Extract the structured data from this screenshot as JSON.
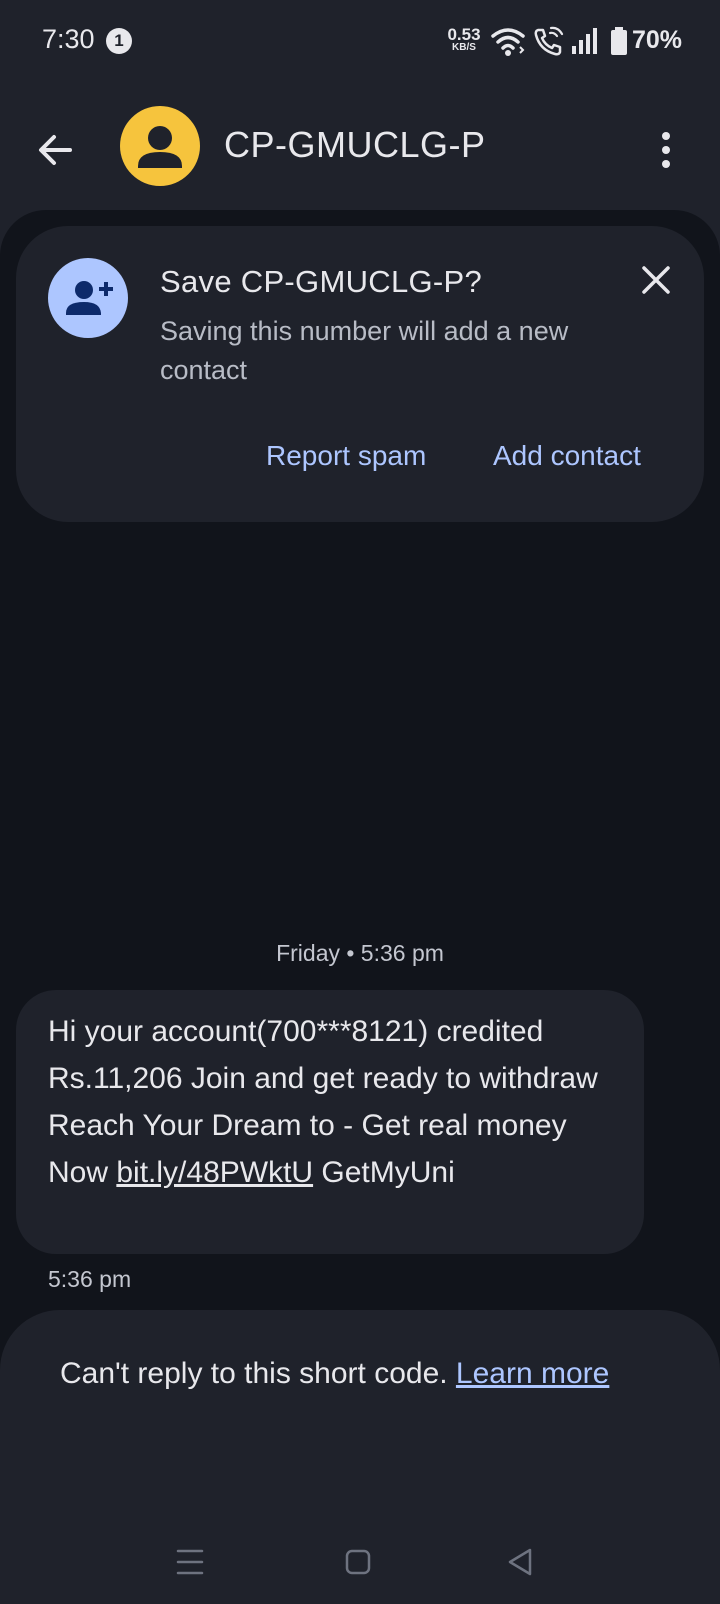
{
  "status_bar": {
    "time": "7:30",
    "notification_count": "1",
    "net_speed_value": "0.53",
    "net_speed_unit": "KB/S",
    "battery": "70%",
    "icons": [
      "wifi-icon",
      "wifi-calling-icon",
      "signal-icon",
      "battery-icon"
    ]
  },
  "app_bar": {
    "title": "CP-GMUCLG-P"
  },
  "save_card": {
    "title": "Save CP-GMUCLG-P?",
    "body": "Saving this number will add a new contact",
    "report_spam": "Report spam",
    "add_contact": "Add contact"
  },
  "conversation": {
    "date_separator": "Friday • 5:36 pm",
    "message": {
      "text_before_link": "Hi your account(700***8121) credited Rs.11,206 Join and get ready to withdraw Reach Your Dream to - Get real money Now ",
      "link": "bit.ly/48PWktU",
      "text_after_link": " GetMyUni",
      "time": "5:36 pm"
    }
  },
  "reply_panel": {
    "text": "Can't reply to this short code. ",
    "link": "Learn more"
  },
  "colors": {
    "background": "#11141b",
    "surface": "#1f222b",
    "accent": "#adc6ff",
    "avatar": "#f6c43d"
  }
}
